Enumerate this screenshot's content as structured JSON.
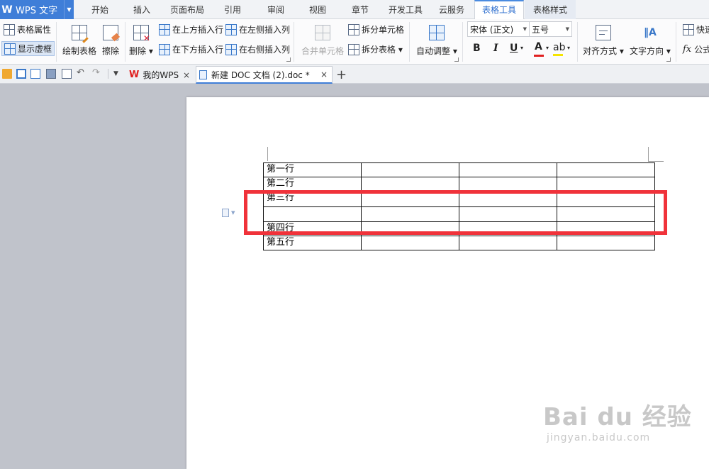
{
  "app": {
    "logo": "W",
    "name": "WPS 文字"
  },
  "menu_tabs": [
    "开始",
    "插入",
    "页面布局",
    "引用",
    "审阅",
    "视图",
    "章节",
    "开发工具",
    "云服务",
    "表格工具",
    "表格样式"
  ],
  "ribbon": {
    "table_properties": "表格属性",
    "show_gridlines": "显示虚框",
    "draw_table": "绘制表格",
    "eraser": "擦除",
    "delete": "删除",
    "insert_row_above": "在上方插入行",
    "insert_row_below": "在下方插入行",
    "insert_col_left": "在左侧插入列",
    "insert_col_right": "在右侧插入列",
    "merge_cells": "合并单元格",
    "split_cells": "拆分单元格",
    "split_table": "拆分表格",
    "auto_fit": "自动调整",
    "font_name": "宋体 (正文)",
    "font_size": "五号",
    "bold": "B",
    "italic": "I",
    "underline": "U",
    "font_color": "A",
    "align": "对齐方式",
    "text_direction": "文字方向",
    "quick_calc": "快速",
    "formula": "公式"
  },
  "colors": {
    "accent": "#3f7ed8",
    "highlight_box": "#f0323a",
    "font_color_bar": "#e02020",
    "highlight_bar": "#f5e400"
  },
  "tabs": [
    {
      "label": "我的WPS",
      "close": "×"
    },
    {
      "label": "新建 DOC 文档 (2).doc *",
      "close": "×"
    }
  ],
  "new_tab": "+",
  "table": {
    "rows": [
      [
        "第一行",
        "",
        "",
        ""
      ],
      [
        "第二行",
        "",
        "",
        ""
      ],
      [
        "第三行",
        "",
        "",
        ""
      ],
      [
        "",
        "",
        "",
        ""
      ],
      [
        "第四行",
        "",
        "",
        ""
      ],
      [
        "第五行",
        "",
        "",
        ""
      ]
    ]
  },
  "watermark": {
    "main": "Bai du 经验",
    "sub": "jingyan.baidu.com"
  }
}
